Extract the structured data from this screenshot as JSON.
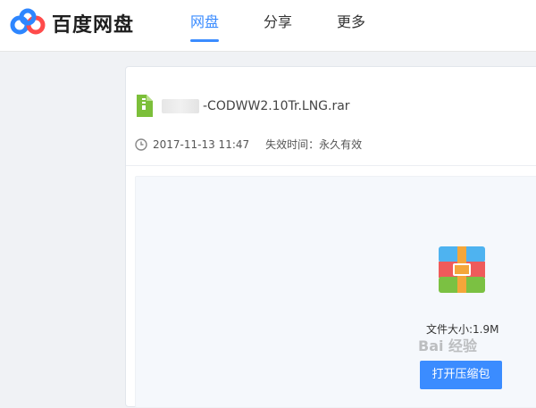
{
  "brand": {
    "name": "百度网盘"
  },
  "nav": {
    "items": [
      {
        "label": "网盘",
        "active": true
      },
      {
        "label": "分享",
        "active": false
      },
      {
        "label": "更多",
        "active": false
      }
    ]
  },
  "file": {
    "name_visible": "-CODWW2.10Tr.LNG.rar",
    "date": "2017-11-13 11:47",
    "expiry": "失效时间：永久有效",
    "size_label": "文件大小:1.9M",
    "open_button_label": "打开压缩包"
  },
  "watermark": {
    "text": "Bai 经验"
  },
  "colors": {
    "accent": "#3b8cff",
    "zip_green": "#7cbf3a"
  },
  "icons": [
    "baidu-cloud-logo-icon",
    "zip-file-icon",
    "clock-icon",
    "archive-box-icon"
  ]
}
